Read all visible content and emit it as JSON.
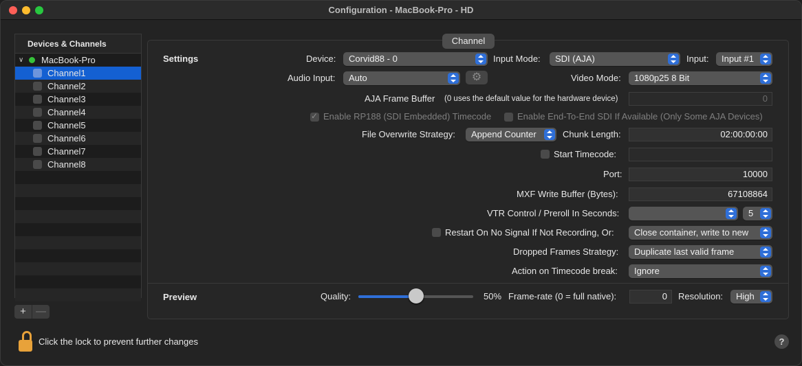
{
  "window": {
    "title": "Configuration - MacBook-Pro - HD"
  },
  "sidebar": {
    "header": "Devices & Channels",
    "device": "MacBook-Pro",
    "channels": [
      "Channel1",
      "Channel2",
      "Channel3",
      "Channel4",
      "Channel5",
      "Channel6",
      "Channel7",
      "Channel8"
    ],
    "add_label": "+",
    "remove_label": "—"
  },
  "tab": {
    "label": "Channel"
  },
  "settings": {
    "section_label": "Settings",
    "device_label": "Device:",
    "device_value": "Corvid88 - 0",
    "input_mode_label": "Input Mode:",
    "input_mode_value": "SDI (AJA)",
    "input_label": "Input:",
    "input_value": "Input #1",
    "audio_input_label": "Audio Input:",
    "audio_input_value": "Auto",
    "video_mode_label": "Video Mode:",
    "video_mode_value": "1080p25 8 Bit",
    "aja_frame_buffer_label": "AJA Frame Buffer",
    "aja_frame_buffer_note": "(0 uses the default value for the hardware device)",
    "aja_frame_buffer_value": "0",
    "rp188_label": "Enable RP188 (SDI Embedded) Timecode",
    "end_to_end_label": "Enable End-To-End SDI If Available (Only Some AJA Devices)",
    "overwrite_label": "File Overwrite Strategy:",
    "overwrite_value": "Append Counter",
    "chunk_length_label": "Chunk Length:",
    "chunk_length_value": "02:00:00:00",
    "start_timecode_label": "Start Timecode:",
    "start_timecode_value": "",
    "port_label": "Port:",
    "port_value": "10000",
    "mxf_buffer_label": "MXF Write Buffer (Bytes):",
    "mxf_buffer_value": "67108864",
    "vtr_label": "VTR Control / Preroll In Seconds:",
    "vtr_value": "",
    "preroll_value": "5",
    "restart_label": "Restart On No Signal If Not Recording, Or:",
    "restart_value": "Close container, write to new",
    "dropped_label": "Dropped Frames Strategy:",
    "dropped_value": "Duplicate last valid frame",
    "tc_break_label": "Action on Timecode break:",
    "tc_break_value": "Ignore"
  },
  "preview": {
    "section_label": "Preview",
    "quality_label": "Quality:",
    "quality_value": 0.5,
    "quality_text": "50%",
    "framerate_label": "Frame-rate (0 = full native):",
    "framerate_value": "0",
    "resolution_label": "Resolution:",
    "resolution_value": "High"
  },
  "footer": {
    "lock_text": "Click the lock to prevent further changes",
    "help": "?"
  },
  "colors": {
    "accent": "#2f6fd8",
    "selection": "#1460d2",
    "status_dot": "#36c23a",
    "lock": "#e8a23a"
  },
  "icons": [
    "chevron-down-icon",
    "status-dot-icon",
    "gear-icon",
    "lock-open-icon",
    "help-icon"
  ]
}
